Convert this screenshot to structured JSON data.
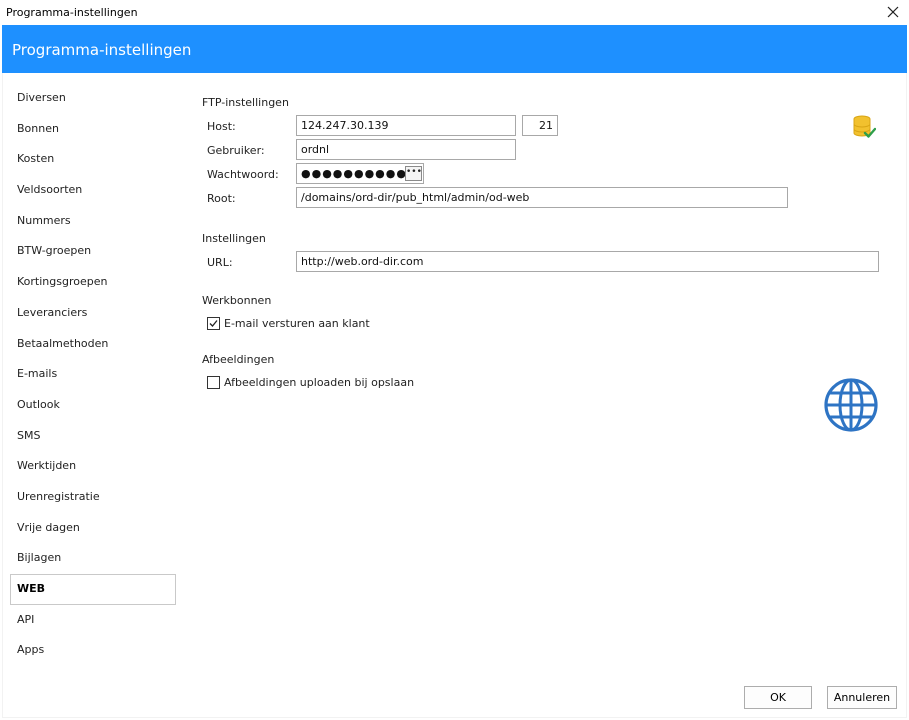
{
  "window": {
    "title": "Programma-instellingen",
    "header_title": "Programma-instellingen"
  },
  "sidebar": {
    "items": [
      {
        "label": "Diversen"
      },
      {
        "label": "Bonnen"
      },
      {
        "label": "Kosten"
      },
      {
        "label": "Veldsoorten"
      },
      {
        "label": "Nummers"
      },
      {
        "label": "BTW-groepen"
      },
      {
        "label": "Kortingsgroepen"
      },
      {
        "label": "Leveranciers"
      },
      {
        "label": "Betaalmethoden"
      },
      {
        "label": "E-mails"
      },
      {
        "label": "Outlook"
      },
      {
        "label": "SMS"
      },
      {
        "label": "Werktijden"
      },
      {
        "label": "Urenregistratie"
      },
      {
        "label": "Vrije dagen"
      },
      {
        "label": "Bijlagen"
      },
      {
        "label": "WEB"
      },
      {
        "label": "API"
      },
      {
        "label": "Apps"
      }
    ],
    "active": "WEB"
  },
  "ftp": {
    "section_title": "FTP-instellingen",
    "host_label": "Host:",
    "host_value": "124.247.30.139",
    "port_value": "21",
    "user_label": "Gebruiker:",
    "user_value": "ordnl",
    "password_label": "Wachtwoord:",
    "password_value": "●●●●●●●●●●",
    "password_button": "•••",
    "root_label": "Root:",
    "root_value": "/domains/ord-dir/pub_html/admin/od-web"
  },
  "settings": {
    "section_title": "Instellingen",
    "url_label": "URL:",
    "url_value": "http://web.ord-dir.com"
  },
  "workorders": {
    "section_title": "Werkbonnen",
    "email_label": "E-mail versturen aan klant",
    "email_checked": true
  },
  "images": {
    "section_title": "Afbeeldingen",
    "upload_label": "Afbeeldingen uploaden bij opslaan",
    "upload_checked": false
  },
  "buttons": {
    "ok": "OK",
    "cancel": "Annuleren"
  },
  "icons": {
    "database": "database-check-icon",
    "globe": "globe-icon",
    "close": "close-icon"
  },
  "colors": {
    "header": "#1e90ff",
    "database_yellow": "#f2c12e",
    "check_green": "#2e9e4a",
    "globe_blue": "#2e74c4"
  }
}
